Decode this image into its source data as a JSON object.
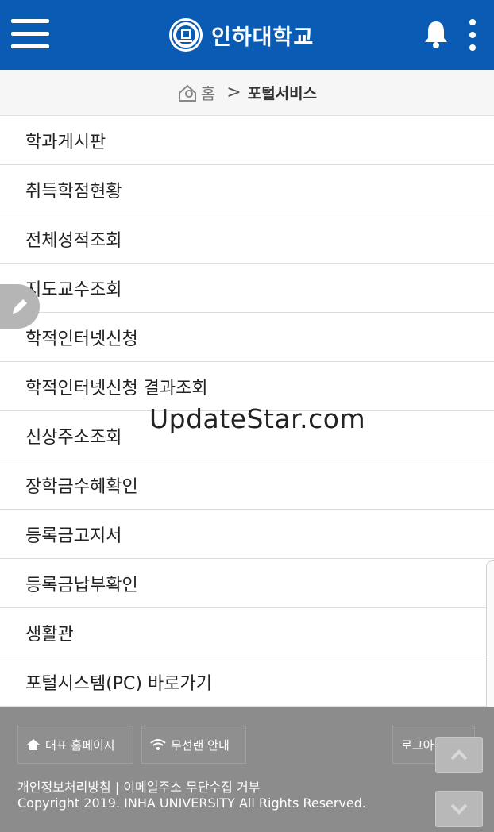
{
  "header": {
    "brand": "인하대학교",
    "colors": {
      "bar": "#0a5bb4",
      "icon": "#ffffff"
    }
  },
  "breadcrumb": {
    "home": "홈",
    "separator": ">",
    "current": "포털서비스"
  },
  "menu": {
    "items": [
      "학과게시판",
      "취득학점현황",
      "전체성적조회",
      "지도교수조회",
      "학적인터넷신청",
      "학적인터넷신청 결과조회",
      "신상주소조회",
      "장학금수혜확인",
      "등록금고지서",
      "등록금납부확인",
      "생활관",
      "포털시스템(PC) 바로가기"
    ]
  },
  "watermark": "UpdateStar.com",
  "footer": {
    "home_button": "대표 홈페이지",
    "wifi_button": "무선랜 안내",
    "logout_button": "로그아웃",
    "policy": "개인정보처리방침 | 이메일주소 무단수집 거부",
    "copyright": "Copyright 2019. INHA UNIVERSITY All Rights Reserved."
  }
}
